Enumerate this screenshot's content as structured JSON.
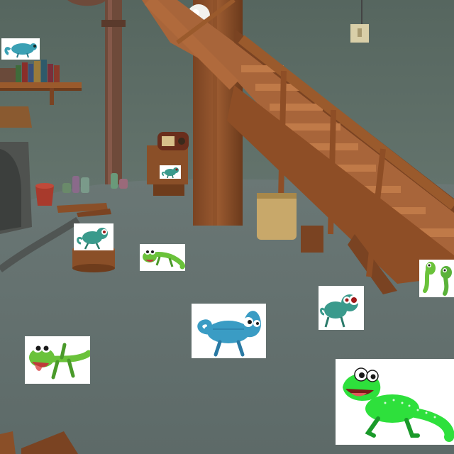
{
  "scene": {
    "setting": "basement-room-with-wooden-staircase",
    "colors": {
      "wall": "#5e6e68",
      "floor": "#6b7876",
      "wood": "#9a5a2c",
      "wood_dark": "#6e3c1c",
      "lamp": "#f2f2ee"
    }
  },
  "lizards": [
    {
      "id": "blue-chameleon-on-shelf",
      "kind": "chameleon",
      "body_color": "#3aa0b4"
    },
    {
      "id": "teal-chameleon-on-radio",
      "kind": "chameleon",
      "body_color": "#3a9a8c"
    },
    {
      "id": "teal-chameleon-on-stump",
      "kind": "chameleon",
      "body_color": "#3a9a8c"
    },
    {
      "id": "green-gecko-middle",
      "kind": "gecko",
      "body_color": "#6ac23a"
    },
    {
      "id": "green-geckos-pair-right",
      "kind": "gecko-pair",
      "body_color": "#6ac23a"
    },
    {
      "id": "teal-chameleon-right",
      "kind": "chameleon",
      "body_color": "#3a9a8c"
    },
    {
      "id": "blue-chameleon-center",
      "kind": "chameleon",
      "body_color": "#3a9cc4"
    },
    {
      "id": "green-gecko-left",
      "kind": "gecko",
      "body_color": "#6ac23a"
    },
    {
      "id": "bright-green-gecko-large",
      "kind": "gecko",
      "body_color": "#2ee03c"
    }
  ]
}
